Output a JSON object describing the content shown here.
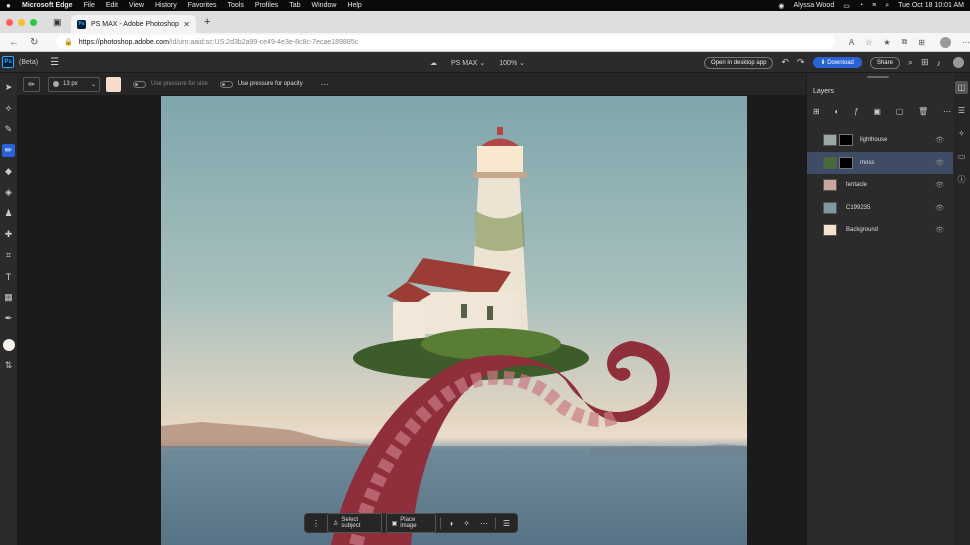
{
  "macmenu": {
    "app": "Microsoft Edge",
    "items": [
      "File",
      "Edit",
      "View",
      "History",
      "Favorites",
      "Tools",
      "Profiles",
      "Tab",
      "Window",
      "Help"
    ],
    "user": "Alyssa Wood",
    "datetime": "Tue Oct 18  10:01 AM"
  },
  "browser": {
    "tab_title": "PS MAX - Adobe Photoshop",
    "url_domain": "https://photoshop.adobe.com",
    "url_path": "/id/urn:aaid:sc:US:2d3b2a99-ce49-4e3e-8c8c-7ecae189885c"
  },
  "app": {
    "beta": "(Beta)",
    "doc_name": "PS MAX",
    "zoom": "100%",
    "open_desktop": "Open in desktop app",
    "download": "Download",
    "share": "Share"
  },
  "options": {
    "brush_size": "13 px",
    "pressure_size": "Use pressure for size",
    "pressure_opacity": "Use pressure for opacity",
    "more": "···"
  },
  "context_bar": {
    "select_subject": "Select subject",
    "place_image": "Place image"
  },
  "panel": {
    "title": "Layers",
    "layers": [
      {
        "name": "lighthouse",
        "selected": false
      },
      {
        "name": "moss",
        "selected": true
      },
      {
        "name": "tentacle",
        "selected": false
      },
      {
        "name": "C199235",
        "selected": false
      },
      {
        "name": "Background",
        "selected": false
      }
    ]
  },
  "colors": {
    "accent": "#2a63d6",
    "selected_layer": "#3e4c66"
  }
}
